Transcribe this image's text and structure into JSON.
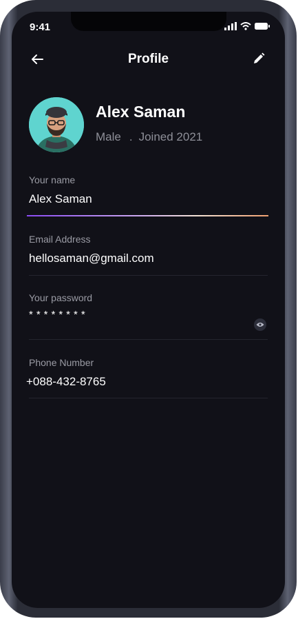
{
  "status_bar": {
    "time": "9:41"
  },
  "header": {
    "title": "Profile",
    "back_icon": "arrow-left-icon",
    "edit_icon": "pencil-icon"
  },
  "profile": {
    "name": "Alex Saman",
    "gender": "Male",
    "separator": ".",
    "joined": "Joined 2021"
  },
  "fields": {
    "name": {
      "label": "Your name",
      "value": "Alex Saman"
    },
    "email": {
      "label": "Email Address",
      "value": "hellosaman@gmail.com"
    },
    "password": {
      "label": "Your password",
      "value": "********"
    },
    "phone": {
      "label": "Phone Number",
      "value": "+088-432-8765"
    }
  },
  "colors": {
    "background": "#111118",
    "accent_start": "#8a4af3",
    "accent_end": "#f0a070"
  }
}
